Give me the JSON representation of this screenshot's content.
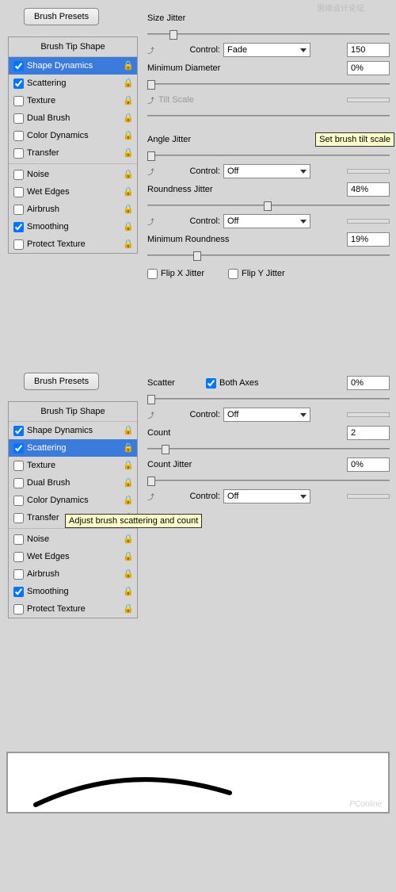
{
  "common": {
    "brush_presets": "Brush Presets",
    "brush_tip_shape": "Brush Tip Shape",
    "shelf_items": [
      "Shape Dynamics",
      "Scattering",
      "Texture",
      "Dual Brush",
      "Color Dynamics",
      "Transfer",
      "Noise",
      "Wet Edges",
      "Airbrush",
      "Smoothing",
      "Protect Texture"
    ]
  },
  "panel1": {
    "size_jitter": "Size Jitter",
    "control": "Control:",
    "fade": "Fade",
    "fade_val": "150",
    "min_diameter": "Minimum Diameter",
    "min_diameter_val": "0%",
    "tilt_scale": "Tilt Scale",
    "angle_jitter": "Angle Jitter",
    "angle_jitter_val": "0%",
    "off": "Off",
    "roundness_jitter": "Roundness Jitter",
    "roundness_jitter_val": "48%",
    "min_roundness": "Minimum Roundness",
    "min_roundness_val": "19%",
    "flip_x": "Flip X Jitter",
    "flip_y": "Flip Y Jitter",
    "tooltip": "Set brush tilt scale"
  },
  "panel2": {
    "scatter": "Scatter",
    "both_axes": "Both Axes",
    "scatter_val": "0%",
    "control": "Control:",
    "off": "Off",
    "count": "Count",
    "count_val": "2",
    "count_jitter": "Count Jitter",
    "count_jitter_val": "0%",
    "tooltip": "Adjust brush scattering and count"
  },
  "watermarks": {
    "top_right": "思缘设计论坛",
    "brand": "PConline"
  }
}
